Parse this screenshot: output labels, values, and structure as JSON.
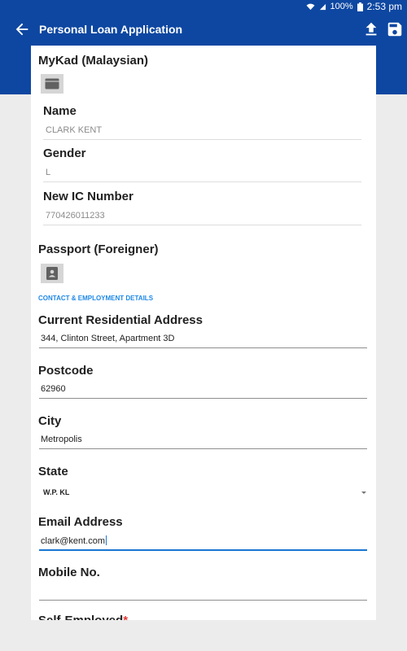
{
  "status_bar": {
    "battery": "100%",
    "time": "2:53 pm",
    "icons": [
      "wifi-icon",
      "signal-icon",
      "battery-icon"
    ]
  },
  "app_bar": {
    "title": "Personal Loan Application",
    "icons": [
      "back-arrow-icon",
      "upload-icon",
      "save-icon"
    ]
  },
  "colors": {
    "primary": "#0d47a1",
    "accent": "#1e88e5",
    "required": "#e53935"
  },
  "mykad": {
    "heading": "MyKad (Malaysian)",
    "icon": "id-card-icon",
    "fields": [
      {
        "label": "Name",
        "value": "CLARK KENT"
      },
      {
        "label": "Gender",
        "value": "L"
      },
      {
        "label": "New IC Number",
        "value": "770426011233"
      }
    ]
  },
  "passport": {
    "heading": "Passport (Foreigner)",
    "icon": "passport-icon"
  },
  "contact": {
    "section_title": "CONTACT & EMPLOYMENT DETAILS",
    "address": {
      "label": "Current Residential Address",
      "value": "344, Clinton Street, Apartment 3D"
    },
    "postcode": {
      "label": "Postcode",
      "value": "62960"
    },
    "city": {
      "label": "City",
      "value": "Metropolis"
    },
    "state": {
      "label": "State",
      "value": "W.P. KL"
    },
    "email": {
      "label": "Email Address",
      "value": "clark@kent.com"
    },
    "mobile": {
      "label": "Mobile No.",
      "value": ""
    },
    "self_employed": {
      "label": "Self-Employed",
      "required_mark": "*"
    }
  }
}
